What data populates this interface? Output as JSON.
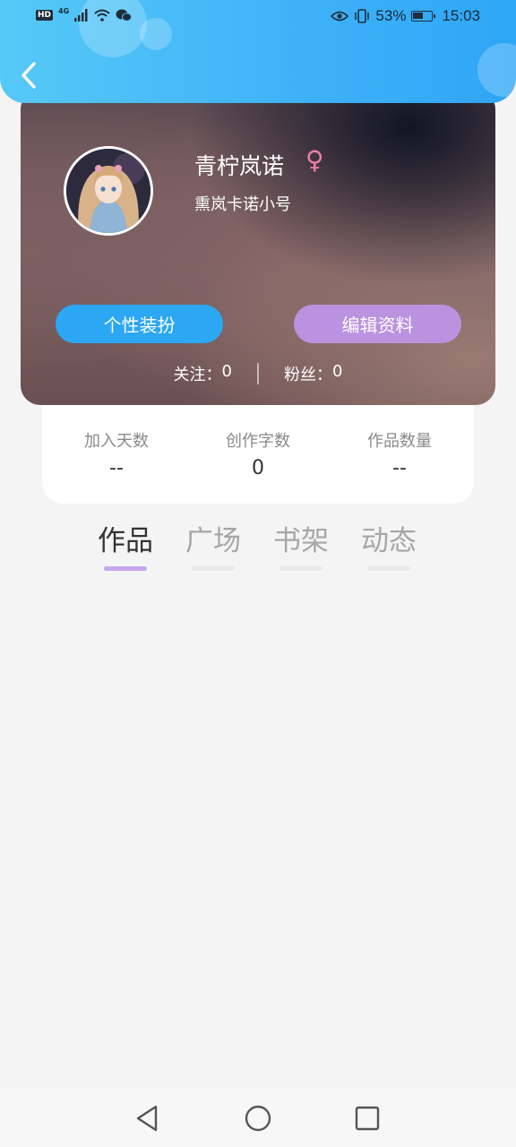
{
  "status_bar": {
    "hd": "HD",
    "network": "4G",
    "battery_percent": "53%",
    "battery_level": 0.53,
    "time": "15:03"
  },
  "profile": {
    "username": "青柠岚诺",
    "gender_symbol": "♀",
    "signature": "熏岚卡诺小号",
    "decorate_button": "个性装扮",
    "edit_button": "编辑资料",
    "follow_label": "关注：",
    "follow_count": "0",
    "fans_label": "粉丝：",
    "fans_count": "0"
  },
  "stats": [
    {
      "label": "加入天数",
      "value": "--"
    },
    {
      "label": "创作字数",
      "value": "0"
    },
    {
      "label": "作品数量",
      "value": "--"
    }
  ],
  "tabs": [
    {
      "label": "作品",
      "active": true
    },
    {
      "label": "广场",
      "active": false
    },
    {
      "label": "书架",
      "active": false
    },
    {
      "label": "动态",
      "active": false
    }
  ],
  "colors": {
    "header_blue": "#3fb3f8",
    "decorate_button": "#2ba7f4",
    "edit_button": "#bb92e0",
    "gender_pink": "#ef7fa5",
    "active_tab_underline": "#c7a6ee"
  },
  "icons": {
    "back": "chevron-left-icon",
    "gender": "female-icon",
    "nav_back": "triangle-back-icon",
    "nav_home": "circle-home-icon",
    "nav_recent": "square-recent-icon"
  }
}
